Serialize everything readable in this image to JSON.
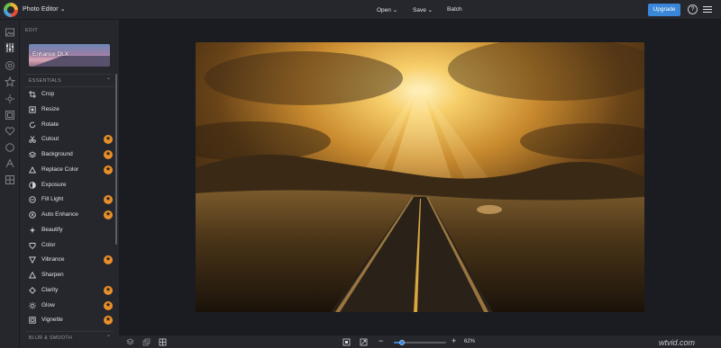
{
  "app": {
    "title": "Photo Editor ⌄"
  },
  "menu": {
    "open": "Open ⌄",
    "save": "Save ⌄",
    "batch": "Batch"
  },
  "header": {
    "upgrade": "Upgrade",
    "help": "?"
  },
  "panel": {
    "edit_label": "EDIT",
    "enhance_card": "Enhance DLX",
    "essentials": "ESSENTIALS",
    "blur_smooth": "BLUR & SMOOTH",
    "tools": [
      {
        "label": "Crop",
        "icon": "crop-icon",
        "premium": false
      },
      {
        "label": "Resize",
        "icon": "resize-icon",
        "premium": false
      },
      {
        "label": "Rotate",
        "icon": "rotate-icon",
        "premium": false
      },
      {
        "label": "Cutout",
        "icon": "scissors-icon",
        "premium": true
      },
      {
        "label": "Background",
        "icon": "layers-icon",
        "premium": true
      },
      {
        "label": "Replace Color",
        "icon": "triangle-icon",
        "premium": true
      },
      {
        "label": "Exposure",
        "icon": "exposure-icon",
        "premium": false
      },
      {
        "label": "Fill Light",
        "icon": "fill-light-icon",
        "premium": true
      },
      {
        "label": "Auto Enhance",
        "icon": "auto-enhance-icon",
        "premium": true
      },
      {
        "label": "Beautify",
        "icon": "sparkle-icon",
        "premium": false
      },
      {
        "label": "Color",
        "icon": "color-icon",
        "premium": false
      },
      {
        "label": "Vibrance",
        "icon": "vibrance-icon",
        "premium": true
      },
      {
        "label": "Sharpen",
        "icon": "sharpen-icon",
        "premium": false
      },
      {
        "label": "Clarity",
        "icon": "clarity-icon",
        "premium": true
      },
      {
        "label": "Glow",
        "icon": "glow-icon",
        "premium": true
      },
      {
        "label": "Vignette",
        "icon": "vignette-icon",
        "premium": true
      }
    ]
  },
  "zoom": {
    "value": 62,
    "label": "62%",
    "minus": "−",
    "plus": "+"
  },
  "watermark": "wtvid.com",
  "colors": {
    "accent": "#3a86d8",
    "premium": "#e8902a",
    "panel": "#26272d",
    "canvas": "#1b1c21"
  }
}
